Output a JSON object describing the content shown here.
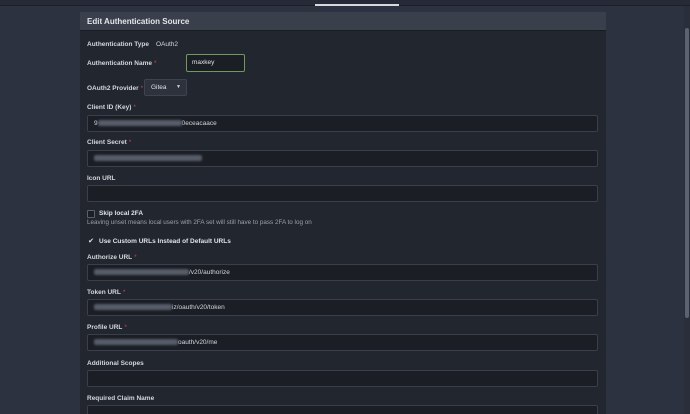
{
  "panel": {
    "title": "Edit Authentication Source"
  },
  "auth_type": {
    "label": "Authentication Type",
    "value": "OAuth2"
  },
  "auth_name": {
    "label": "Authentication Name",
    "value": "maxkey"
  },
  "provider": {
    "label": "OAuth2 Provider",
    "value": "Gitea"
  },
  "client_id": {
    "label": "Client ID (Key)",
    "value_start": "9",
    "value_end": "0eceacaace"
  },
  "client_secret": {
    "label": "Client Secret"
  },
  "icon_url": {
    "label": "Icon URL",
    "value": ""
  },
  "skip_2fa": {
    "label": "Skip local 2FA",
    "checked": false,
    "help": "Leaving unset means local users with 2FA set will still have to pass 2FA to log on"
  },
  "custom_urls": {
    "label": "Use Custom URLs Instead of Default URLs",
    "checked": true
  },
  "authorize_url": {
    "label": "Authorize URL",
    "value_tail": "/v20/authorize"
  },
  "token_url": {
    "label": "Token URL",
    "value_tail": "iz/oauth/v20/token"
  },
  "profile_url": {
    "label": "Profile URL",
    "value_tail": "oauth/v20/me"
  },
  "scopes": {
    "label": "Additional Scopes",
    "value": ""
  },
  "claim_name": {
    "label": "Required Claim Name"
  }
}
